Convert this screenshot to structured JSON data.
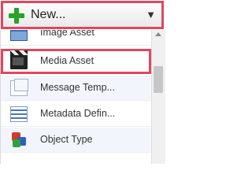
{
  "new_button": {
    "label": "New...",
    "arrow": "▼"
  },
  "menu": {
    "items": [
      {
        "label": "Image Asset",
        "icon": "image-asset-icon"
      },
      {
        "label": "Media Asset",
        "icon": "media-asset-icon",
        "selected": true
      },
      {
        "label": "Message Temp...",
        "icon": "message-template-icon"
      },
      {
        "label": "Metadata Defin...",
        "icon": "metadata-definition-icon"
      },
      {
        "label": "Object Type",
        "icon": "object-type-icon"
      }
    ]
  },
  "colors": {
    "highlight": "#e0475f",
    "plus": "#27a327"
  }
}
